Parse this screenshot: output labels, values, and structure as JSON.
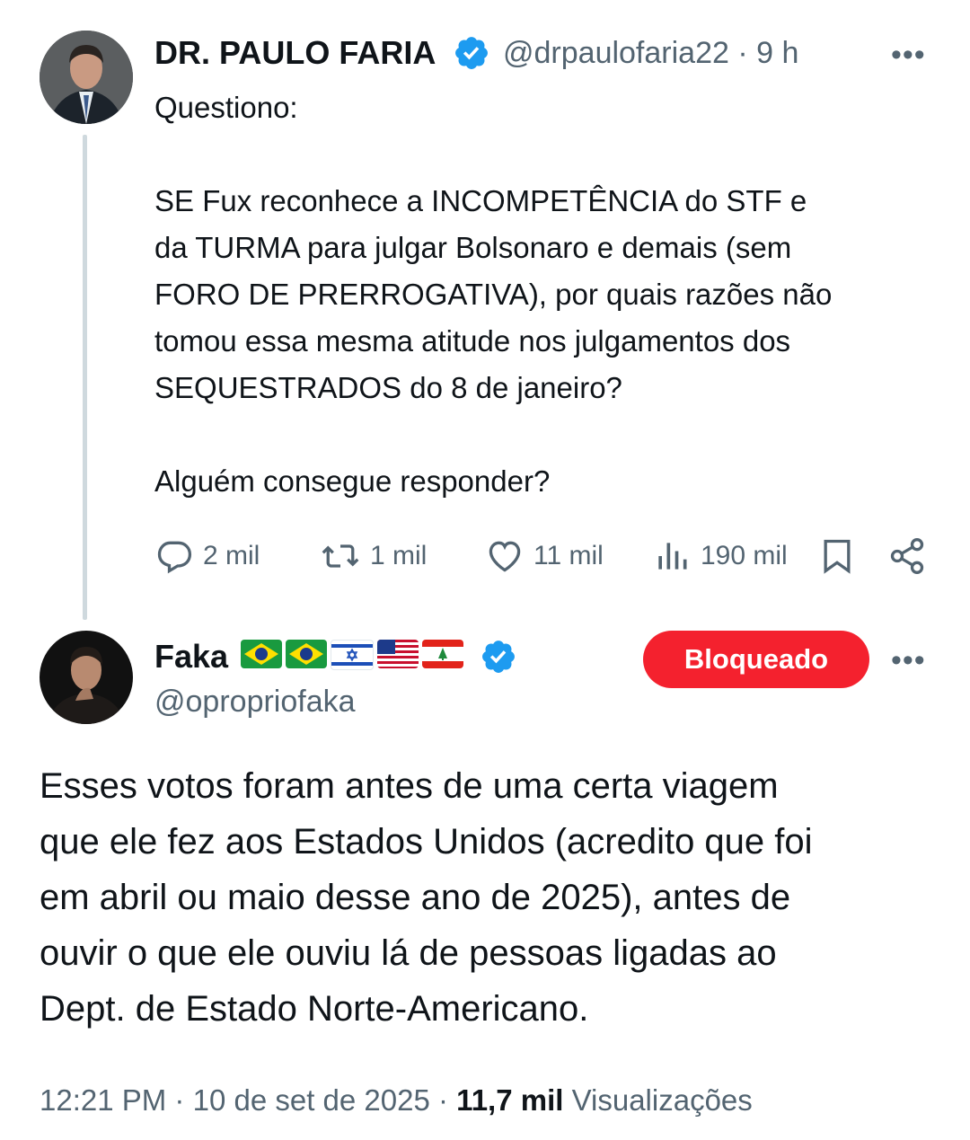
{
  "tweet": {
    "author_name": "DR. PAULO FARIA",
    "handle": "@drpaulofaria22",
    "separator": "·",
    "time": "9 h",
    "body": "Questiono:\n\nSE Fux reconhece a INCOMPETÊNCIA do STF e\nda TURMA para julgar Bolsonaro e demais (sem\nFORO DE PRERROGATIVA), por quais razões não\ntomou essa mesma atitude nos julgamentos dos\nSEQUESTRADOS do 8 de janeiro?\n\nAlguém consegue responder?",
    "replies": "2 mil",
    "retweets": "1 mil",
    "likes": "11 mil",
    "views": "190 mil",
    "more": "•••"
  },
  "reply": {
    "author_name": "Faka",
    "handle": "@opropriofaka",
    "flags": [
      "brazil-flag",
      "brazil-flag",
      "israel-flag",
      "usa-flag",
      "lebanon-flag"
    ],
    "blocked_label": "Bloqueado",
    "more": "•••",
    "body": "Esses votos foram antes de uma certa viagem\nque ele fez aos Estados Unidos (acredito que foi\nem abril ou maio desse ano de 2025), antes de\nouvir o que ele ouviu lá de pessoas ligadas ao\nDept. de Estado Norte-Americano.",
    "time": "12:21 PM",
    "date": "10 de set de 2025",
    "separator": "·",
    "views_count": "11,7 mil",
    "views_label": "Visualizações"
  },
  "colors": {
    "verified": "#1d9bf0",
    "blocked": "#f4212e",
    "secondary_text": "#536471"
  }
}
